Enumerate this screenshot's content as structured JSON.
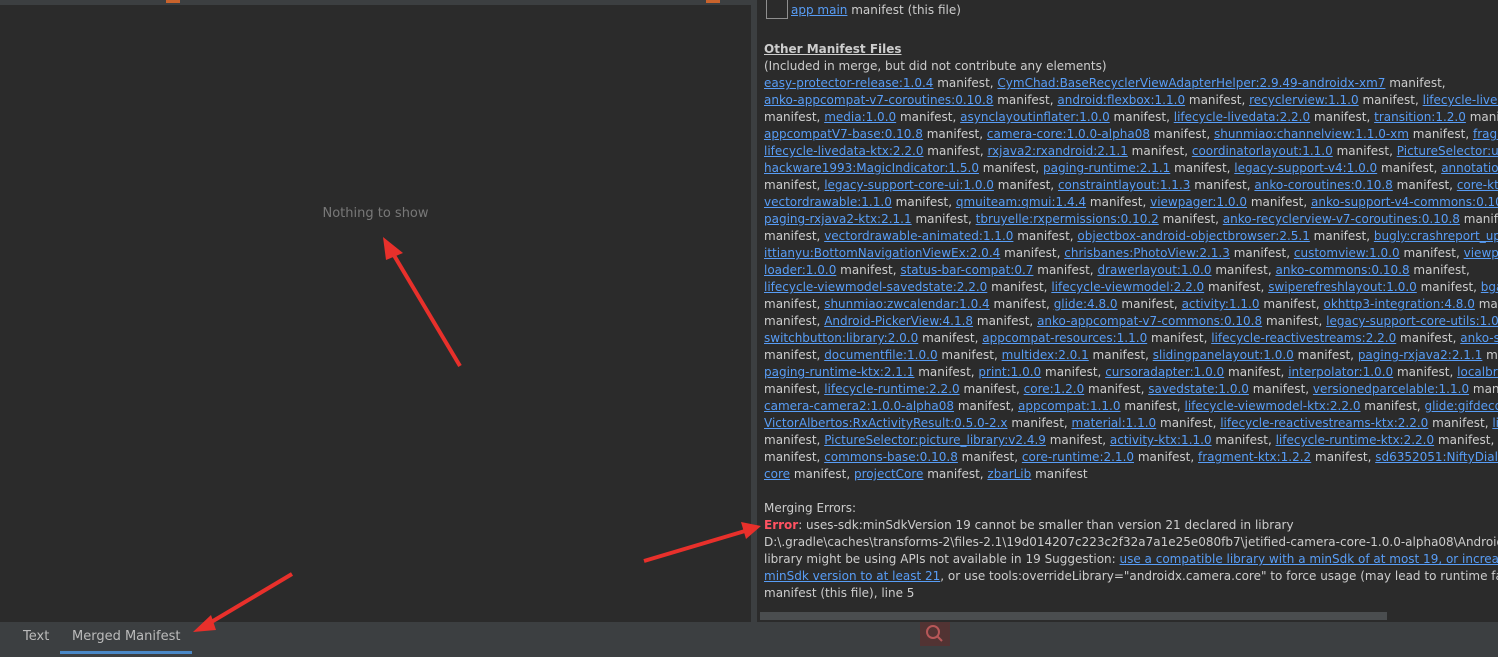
{
  "left_panel": {
    "empty_text": "Nothing to show"
  },
  "right_panel": {
    "lines": [
      [
        {
          "t": "app main",
          "k": "link"
        },
        {
          "t": " manifest (this file)"
        }
      ],
      [
        {
          "t": "Other Manifest Files",
          "k": "heading"
        }
      ],
      [
        {
          "t": "(Included in merge, but did not contribute any elements)"
        }
      ],
      [
        {
          "t": "easy-protector-release:1.0.4",
          "k": "link"
        },
        {
          "t": " manifest, "
        },
        {
          "t": "CymChad:BaseRecyclerViewAdapterHelper:2.9.49-androidx-xm7",
          "k": "link"
        },
        {
          "t": " manifest,"
        }
      ],
      [
        {
          "t": "anko-appcompat-v7-coroutines:0.10.8",
          "k": "link"
        },
        {
          "t": " manifest, "
        },
        {
          "t": "android:flexbox:1.1.0",
          "k": "link"
        },
        {
          "t": " manifest, "
        },
        {
          "t": "recyclerview:1.1.0",
          "k": "link"
        },
        {
          "t": " manifest, "
        },
        {
          "t": "lifecycle-livedata-co",
          "k": "link"
        }
      ],
      [
        {
          "t": "manifest, "
        },
        {
          "t": "media:1.0.0",
          "k": "link"
        },
        {
          "t": " manifest, "
        },
        {
          "t": "asynclayoutinflater:1.0.0",
          "k": "link"
        },
        {
          "t": " manifest, "
        },
        {
          "t": "lifecycle-livedata:2.2.0",
          "k": "link"
        },
        {
          "t": " manifest, "
        },
        {
          "t": "transition:1.2.0",
          "k": "link"
        },
        {
          "t": " manifest,"
        }
      ],
      [
        {
          "t": "appcompatV7-base:0.10.8",
          "k": "link"
        },
        {
          "t": " manifest, "
        },
        {
          "t": "camera-core:1.0.0-alpha08",
          "k": "link"
        },
        {
          "t": " manifest, "
        },
        {
          "t": "shunmiao:channelview:1.1.0-xm",
          "k": "link"
        },
        {
          "t": " manifest, "
        },
        {
          "t": "fragment:1.",
          "k": "link"
        }
      ],
      [
        {
          "t": "lifecycle-livedata-ktx:2.2.0",
          "k": "link"
        },
        {
          "t": " manifest, "
        },
        {
          "t": "rxjava2:rxandroid:2.1.1",
          "k": "link"
        },
        {
          "t": " manifest, "
        },
        {
          "t": "coordinatorlayout:1.1.0",
          "k": "link"
        },
        {
          "t": " manifest, "
        },
        {
          "t": "PictureSelector:ucrop:v2.",
          "k": "link"
        }
      ],
      [
        {
          "t": "hackware1993:MagicIndicator:1.5.0",
          "k": "link"
        },
        {
          "t": " manifest, "
        },
        {
          "t": "paging-runtime:2.1.1",
          "k": "link"
        },
        {
          "t": " manifest, "
        },
        {
          "t": "legacy-support-v4:1.0.0",
          "k": "link"
        },
        {
          "t": " manifest, "
        },
        {
          "t": "annotation-expe",
          "k": "link"
        }
      ],
      [
        {
          "t": "manifest, "
        },
        {
          "t": "legacy-support-core-ui:1.0.0",
          "k": "link"
        },
        {
          "t": " manifest, "
        },
        {
          "t": "constraintlayout:1.1.3",
          "k": "link"
        },
        {
          "t": " manifest, "
        },
        {
          "t": "anko-coroutines:0.10.8",
          "k": "link"
        },
        {
          "t": " manifest, "
        },
        {
          "t": "core-ktx:1.2.0",
          "k": "link"
        }
      ],
      [
        {
          "t": "vectordrawable:1.1.0",
          "k": "link"
        },
        {
          "t": " manifest, "
        },
        {
          "t": "qmuiteam:qmui:1.4.4",
          "k": "link"
        },
        {
          "t": " manifest, "
        },
        {
          "t": "viewpager:1.0.0",
          "k": "link"
        },
        {
          "t": " manifest, "
        },
        {
          "t": "anko-support-v4-commons:0.10.8",
          "k": "link"
        },
        {
          "t": " manifest"
        }
      ],
      [
        {
          "t": "paging-rxjava2-ktx:2.1.1",
          "k": "link"
        },
        {
          "t": " manifest, "
        },
        {
          "t": "tbruyelle:rxpermissions:0.10.2",
          "k": "link"
        },
        {
          "t": " manifest, "
        },
        {
          "t": "anko-recyclerview-v7-coroutines:0.10.8",
          "k": "link"
        },
        {
          "t": " manifest, "
        },
        {
          "t": "sup",
          "k": "link"
        }
      ],
      [
        {
          "t": "manifest, "
        },
        {
          "t": "vectordrawable-animated:1.1.0",
          "k": "link"
        },
        {
          "t": " manifest, "
        },
        {
          "t": "objectbox-android-objectbrowser:2.5.1",
          "k": "link"
        },
        {
          "t": " manifest, "
        },
        {
          "t": "bugly:crashreport_upgrad",
          "k": "link"
        }
      ],
      [
        {
          "t": "ittianyu:BottomNavigationViewEx:2.0.4",
          "k": "link"
        },
        {
          "t": " manifest, "
        },
        {
          "t": "chrisbanes:PhotoView:2.1.3",
          "k": "link"
        },
        {
          "t": " manifest, "
        },
        {
          "t": "customview:1.0.0",
          "k": "link"
        },
        {
          "t": " manifest, "
        },
        {
          "t": "viewpager2:1.",
          "k": "link"
        }
      ],
      [
        {
          "t": "loader:1.0.0",
          "k": "link"
        },
        {
          "t": " manifest, "
        },
        {
          "t": "status-bar-compat:0.7",
          "k": "link"
        },
        {
          "t": " manifest, "
        },
        {
          "t": "drawerlayout:1.0.0",
          "k": "link"
        },
        {
          "t": " manifest, "
        },
        {
          "t": "anko-commons:0.10.8",
          "k": "link"
        },
        {
          "t": " manifest,"
        }
      ],
      [
        {
          "t": "lifecycle-viewmodel-savedstate:2.2.0",
          "k": "link"
        },
        {
          "t": " manifest, "
        },
        {
          "t": "lifecycle-viewmodel:2.2.0",
          "k": "link"
        },
        {
          "t": " manifest, "
        },
        {
          "t": "swiperefreshlayout:1.0.0",
          "k": "link"
        },
        {
          "t": " manifest, "
        },
        {
          "t": "bga-qrcod",
          "k": "link"
        }
      ],
      [
        {
          "t": "manifest, "
        },
        {
          "t": "shunmiao:zwcalendar:1.0.4",
          "k": "link"
        },
        {
          "t": " manifest, "
        },
        {
          "t": "glide:4.8.0",
          "k": "link"
        },
        {
          "t": " manifest, "
        },
        {
          "t": "activity:1.1.0",
          "k": "link"
        },
        {
          "t": " manifest, "
        },
        {
          "t": "okhttp3-integration:4.8.0",
          "k": "link"
        },
        {
          "t": " manifest, "
        },
        {
          "t": "ca",
          "k": "link"
        }
      ],
      [
        {
          "t": "manifest, "
        },
        {
          "t": "Android-PickerView:4.1.8",
          "k": "link"
        },
        {
          "t": " manifest, "
        },
        {
          "t": "anko-appcompat-v7-commons:0.10.8",
          "k": "link"
        },
        {
          "t": " manifest, "
        },
        {
          "t": "legacy-support-core-utils:1.0.0",
          "k": "link"
        },
        {
          "t": " m"
        }
      ],
      [
        {
          "t": "switchbutton:library:2.0.0",
          "k": "link"
        },
        {
          "t": " manifest, "
        },
        {
          "t": "appcompat-resources:1.1.0",
          "k": "link"
        },
        {
          "t": " manifest, "
        },
        {
          "t": "lifecycle-reactivestreams:2.2.0",
          "k": "link"
        },
        {
          "t": " manifest, "
        },
        {
          "t": "anko-sdk25-c",
          "k": "link"
        }
      ],
      [
        {
          "t": "manifest, "
        },
        {
          "t": "documentfile:1.0.0",
          "k": "link"
        },
        {
          "t": " manifest, "
        },
        {
          "t": "multidex:2.0.1",
          "k": "link"
        },
        {
          "t": " manifest, "
        },
        {
          "t": "slidingpanelayout:1.0.0",
          "k": "link"
        },
        {
          "t": " manifest, "
        },
        {
          "t": "paging-rxjava2:2.1.1",
          "k": "link"
        },
        {
          "t": " manifest,"
        }
      ],
      [
        {
          "t": "paging-runtime-ktx:2.1.1",
          "k": "link"
        },
        {
          "t": " manifest, "
        },
        {
          "t": "print:1.0.0",
          "k": "link"
        },
        {
          "t": " manifest, "
        },
        {
          "t": "cursoradapter:1.0.0",
          "k": "link"
        },
        {
          "t": " manifest, "
        },
        {
          "t": "interpolator:1.0.0",
          "k": "link"
        },
        {
          "t": " manifest, "
        },
        {
          "t": "localbroadcas",
          "k": "link"
        }
      ],
      [
        {
          "t": "manifest, "
        },
        {
          "t": "lifecycle-runtime:2.2.0",
          "k": "link"
        },
        {
          "t": " manifest, "
        },
        {
          "t": "core:1.2.0",
          "k": "link"
        },
        {
          "t": " manifest, "
        },
        {
          "t": "savedstate:1.0.0",
          "k": "link"
        },
        {
          "t": " manifest, "
        },
        {
          "t": "versionedparcelable:1.1.0",
          "k": "link"
        },
        {
          "t": " manifest,"
        }
      ],
      [
        {
          "t": "camera-camera2:1.0.0-alpha08",
          "k": "link"
        },
        {
          "t": " manifest, "
        },
        {
          "t": "appcompat:1.1.0",
          "k": "link"
        },
        {
          "t": " manifest, "
        },
        {
          "t": "lifecycle-viewmodel-ktx:2.2.0",
          "k": "link"
        },
        {
          "t": " manifest, "
        },
        {
          "t": "glide:gifdecoder:4.8",
          "k": "link"
        }
      ],
      [
        {
          "t": "VictorAlbertos:RxActivityResult:0.5.0-2.x",
          "k": "link"
        },
        {
          "t": " manifest, "
        },
        {
          "t": "material:1.1.0",
          "k": "link"
        },
        {
          "t": " manifest, "
        },
        {
          "t": "lifecycle-reactivestreams-ktx:2.2.0",
          "k": "link"
        },
        {
          "t": " manifest, "
        },
        {
          "t": "lifecycle-li",
          "k": "link"
        }
      ],
      [
        {
          "t": "manifest, "
        },
        {
          "t": "PictureSelector:picture_library:v2.4.9",
          "k": "link"
        },
        {
          "t": " manifest, "
        },
        {
          "t": "activity-ktx:1.1.0",
          "k": "link"
        },
        {
          "t": " manifest, "
        },
        {
          "t": "lifecycle-runtime-ktx:2.2.0",
          "k": "link"
        },
        {
          "t": " manifest, "
        },
        {
          "t": "contraryw",
          "k": "link"
        }
      ],
      [
        {
          "t": "manifest, "
        },
        {
          "t": "commons-base:0.10.8",
          "k": "link"
        },
        {
          "t": " manifest, "
        },
        {
          "t": "core-runtime:2.1.0",
          "k": "link"
        },
        {
          "t": " manifest, "
        },
        {
          "t": "fragment-ktx:1.2.2",
          "k": "link"
        },
        {
          "t": " manifest, "
        },
        {
          "t": "sd6352051:NiftyDialogEffect",
          "k": "link"
        }
      ],
      [
        {
          "t": "core",
          "k": "link"
        },
        {
          "t": " manifest, "
        },
        {
          "t": "projectCore",
          "k": "link"
        },
        {
          "t": " manifest, "
        },
        {
          "t": "zbarLib",
          "k": "link"
        },
        {
          "t": " manifest"
        }
      ],
      [
        {
          "t": "Merging Errors:"
        }
      ],
      [
        {
          "t": "Error",
          "k": "error"
        },
        {
          "t": ": uses-sdk:minSdkVersion 19 cannot be smaller than version 21 declared in library"
        }
      ],
      [
        {
          "t": "D:\\.gradle\\caches\\transforms-2\\files-2.1\\19d014207c223c2f32a7a1e25e080fb7\\jetified-camera-core-1.0.0-alpha08\\AndroidMa"
        }
      ],
      [
        {
          "t": "library might be using APIs not available in 19 Suggestion: "
        },
        {
          "t": "use a compatible library with a minSdk of at most 19, or increase th",
          "k": "link"
        }
      ],
      [
        {
          "t": "minSdk version to at least 21",
          "k": "link"
        },
        {
          "t": ", or use tools:overrideLibrary=\"androidx.camera.core\" to force usage (may lead to runtime failure"
        }
      ],
      [
        {
          "t": "manifest (this file), line 5"
        }
      ]
    ]
  },
  "bottom_tabs": [
    {
      "label": "Text",
      "selected": false
    },
    {
      "label": "Merged Manifest",
      "selected": true
    }
  ],
  "icons": {
    "search": "search-icon"
  },
  "colors": {
    "link": "#589df6",
    "error": "#ff5261",
    "annotation_arrow": "#e8302b",
    "tab_underline": "#4a88c7"
  }
}
